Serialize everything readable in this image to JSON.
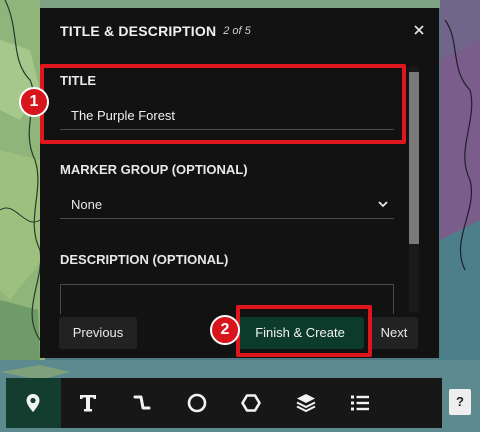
{
  "dialog": {
    "title": "TITLE & DESCRIPTION",
    "step": "2 of 5",
    "close_icon": "close-icon"
  },
  "fields": {
    "title_label": "TITLE",
    "title_value": "The Purple Forest",
    "marker_group_label": "MARKER GROUP (OPTIONAL)",
    "marker_group_value": "None",
    "description_label": "DESCRIPTION (OPTIONAL)"
  },
  "footer": {
    "previous_label": "Previous",
    "finish_label": "Finish & Create",
    "next_label": "Next"
  },
  "annotations": {
    "badge_1": "1",
    "badge_2": "2",
    "highlight_color": "#e0161f"
  },
  "toolbar": {
    "tools": [
      "marker-icon",
      "text-icon",
      "path-icon",
      "circle-icon",
      "polygon-icon",
      "layers-icon",
      "list-icon"
    ],
    "active_tool": "marker-icon",
    "help_label": "?"
  },
  "colors": {
    "accent": "#0c3b2c",
    "active_tool_bg": "#123d2f"
  }
}
